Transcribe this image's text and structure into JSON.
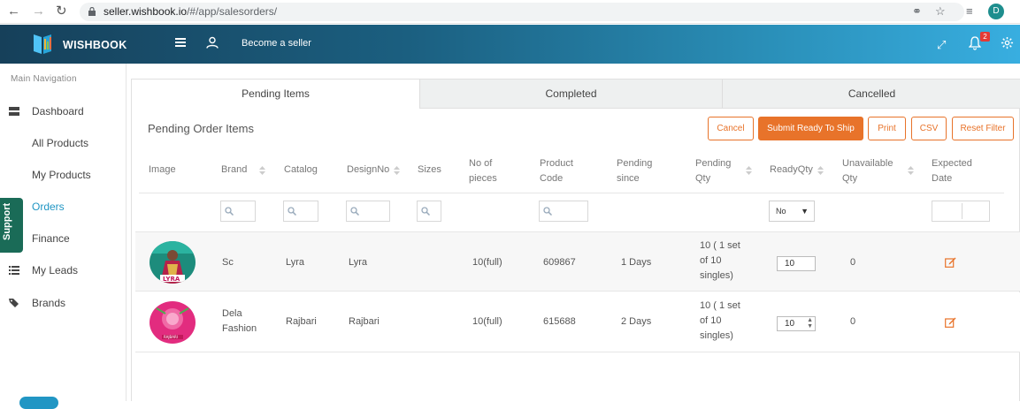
{
  "browser": {
    "url_host": "seller.wishbook.io",
    "url_path": "/#/app/salesorders/",
    "profile_initial": "D"
  },
  "header": {
    "logo_text": "WISHBOOK",
    "become_seller": "Become a seller",
    "notification_count": "2"
  },
  "sidebar": {
    "title": "Main Navigation",
    "support_label": "Support",
    "items": [
      {
        "label": "Dashboard",
        "icon": "dashboard-icon"
      },
      {
        "label": "All Products",
        "icon": "grid-icon"
      },
      {
        "label": "My Products",
        "icon": "list-icon"
      },
      {
        "label": "Orders",
        "icon": "cart-icon",
        "active": true
      },
      {
        "label": "Finance",
        "icon": "file-icon"
      },
      {
        "label": "My Leads",
        "icon": "list-icon"
      },
      {
        "label": "Brands",
        "icon": "tag-icon"
      }
    ]
  },
  "tabs": [
    "Pending Items",
    "Completed",
    "Cancelled"
  ],
  "panel": {
    "title": "Pending Order Items",
    "buttons": {
      "cancel": "Cancel",
      "submit": "Submit Ready To Ship",
      "print": "Print",
      "csv": "CSV",
      "reset": "Reset Filter"
    }
  },
  "table": {
    "columns": {
      "image": "Image",
      "brand": "Brand",
      "catalog": "Catalog",
      "design_no": "DesignNo",
      "sizes": "Sizes",
      "pieces_1": "No of",
      "pieces_2": "pieces",
      "code_1": "Product",
      "code_2": "Code",
      "since_1": "Pending",
      "since_2": "since",
      "pqty_1": "Pending",
      "pqty_2": "Qty",
      "ready_qty": "ReadyQty",
      "unavail_1": "Unavailable",
      "unavail_2": "Qty",
      "exp_1": "Expected",
      "exp_2": "Date"
    },
    "ready_filter": "No",
    "rows": [
      {
        "brand_1": "Sc",
        "brand_2": "",
        "catalog": "Lyra",
        "design_no": "Lyra",
        "pieces": "10(full)",
        "code": "609867",
        "since": "1 Days",
        "pqty_1": "10 ( 1 set",
        "pqty_2": "of 10",
        "pqty_3": "singles)",
        "ready_qty": "10",
        "unavailable": "0"
      },
      {
        "brand_1": "Dela",
        "brand_2": "Fashion",
        "catalog": "Rajbari",
        "design_no": "Rajbari",
        "pieces": "10(full)",
        "code": "615688",
        "since": "2 Days",
        "pqty_1": "10 ( 1 set",
        "pqty_2": "of 10",
        "pqty_3": "singles)",
        "ready_qty": "10",
        "unavailable": "0"
      }
    ]
  }
}
